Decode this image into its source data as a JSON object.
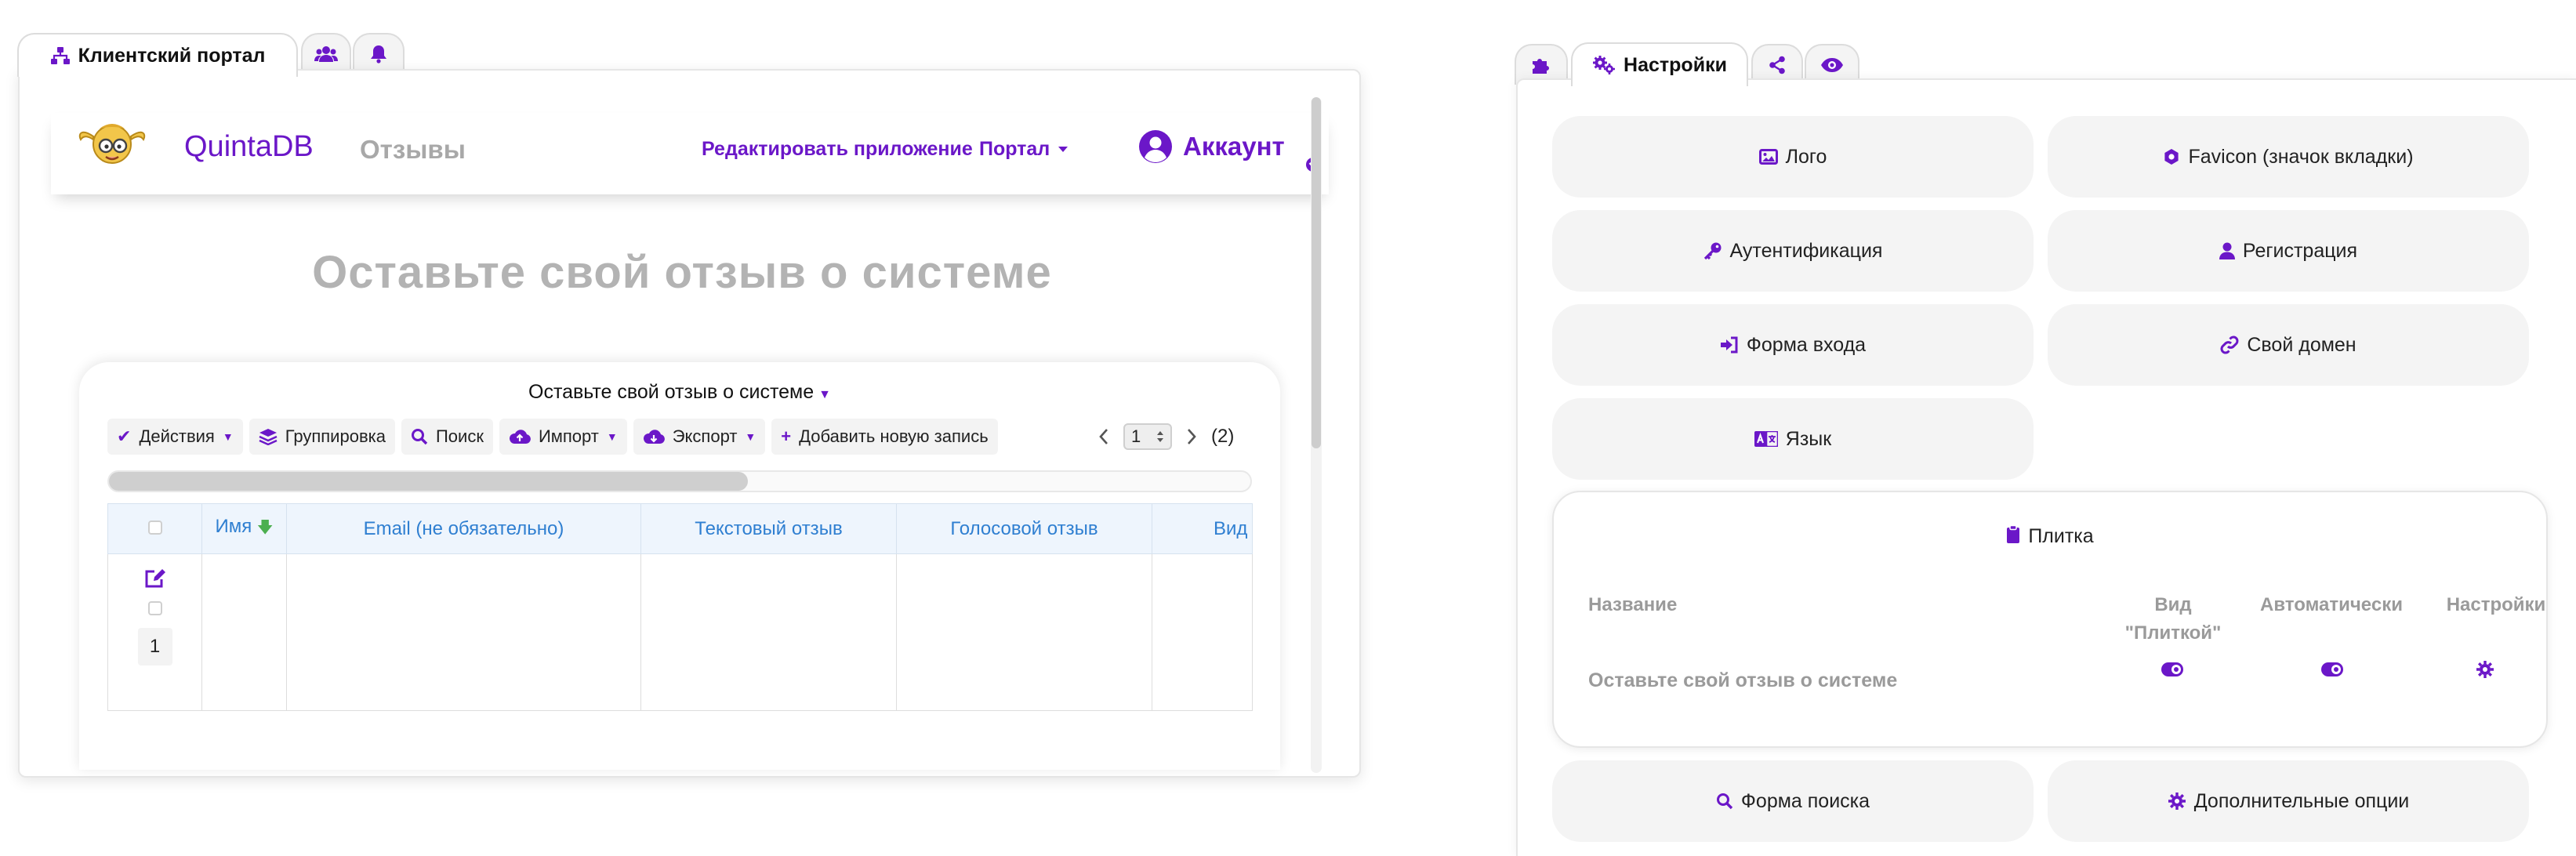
{
  "left_tabs": [
    {
      "label": "Клиентский портал",
      "icon": "sitemap-icon",
      "active": true
    },
    {
      "label": "",
      "icon": "users-icon",
      "active": false
    },
    {
      "label": "",
      "icon": "bell-icon",
      "active": false
    }
  ],
  "portal": {
    "brand": "QuintaDB",
    "app_name": "Отзывы",
    "edit_app": "Редактировать приложение",
    "portal_menu": "Портал",
    "account": "Аккаунт",
    "heading": "Оставьте свой отзыв о системе"
  },
  "form": {
    "title": "Оставьте свой отзыв о системе",
    "toolbar": {
      "actions": "Действия",
      "grouping": "Группировка",
      "search": "Поиск",
      "import": "Импорт",
      "export": "Экспорт",
      "add_record": "Добавить новую запись"
    },
    "pager": {
      "page": "1",
      "total": "(2)"
    },
    "scroll_fraction": 0.56,
    "columns": [
      "Имя",
      "Email (не обязательно)",
      "Текстовый отзыв",
      "Голосовой отзыв",
      "Вид"
    ],
    "row_number": "1"
  },
  "right_tabs": [
    {
      "label": "",
      "icon": "puzzle-icon",
      "active": false
    },
    {
      "label": "Настройки",
      "icon": "gears-icon",
      "active": true
    },
    {
      "label": "",
      "icon": "share-icon",
      "active": false
    },
    {
      "label": "",
      "icon": "eye-icon",
      "active": false
    }
  ],
  "settings": {
    "logo": "Лого",
    "favicon": "Favicon (значок вкладки)",
    "authentication": "Аутентификация",
    "registration": "Регистрация",
    "login_form": "Форма входа",
    "custom_domain": "Свой домен",
    "language": "Язык",
    "search_form": "Форма поиска",
    "extra_options": "Дополнительные опции"
  },
  "tile": {
    "title": "Плитка",
    "col_name": "Название",
    "col_tile_view_1": "Вид",
    "col_tile_view_2": "\"Плиткой\"",
    "col_auto": "Автоматически",
    "col_settings": "Настройки",
    "row_name": "Оставьте свой отзыв о системе",
    "tile_view_on": true,
    "auto_on": true
  },
  "colors": {
    "accent": "#6b17c8",
    "link_blue": "#2f7fd1",
    "muted": "#9a9a9a"
  }
}
